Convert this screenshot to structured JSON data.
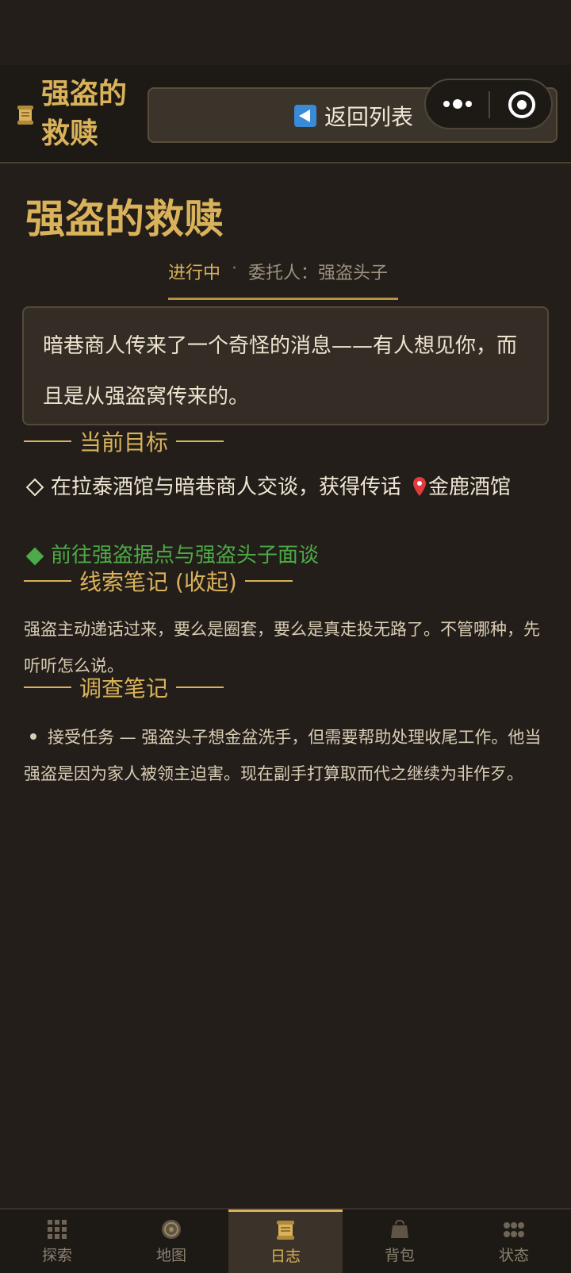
{
  "header": {
    "title": "强盗的救赎",
    "back_label": "返回列表"
  },
  "quest": {
    "title": "强盗的救赎",
    "status": "进行中",
    "separator": "·",
    "client": "委托人：强盗头子",
    "description": "暗巷商人传来了一个奇怪的消息——有人想见你，而且是从强盗窝传来的。"
  },
  "objectives": {
    "heading": "当前目标",
    "items": [
      {
        "text": "在拉泰酒馆与暗巷商人交谈，获得传话",
        "location": "金鹿酒馆",
        "done": false
      },
      {
        "text": "前往强盗据点与强盗头子面谈",
        "done": false,
        "current": true
      }
    ]
  },
  "clues": {
    "heading": "线索笔记 (收起)",
    "text": "强盗主动递话过来，要么是圈套，要么是真走投无路了。不管哪种，先听听怎么说。"
  },
  "investigation": {
    "heading": "调查笔记",
    "entries": [
      "接受任务 — 强盗头子想金盆洗手，但需要帮助处理收尾工作。他当强盗是因为家人被领主迫害。现在副手打算取而代之继续为非作歹。"
    ]
  },
  "tabs": [
    {
      "label": "探索",
      "icon": "grid-icon"
    },
    {
      "label": "地图",
      "icon": "compass-icon"
    },
    {
      "label": "日志",
      "icon": "scroll-icon",
      "active": true
    },
    {
      "label": "背包",
      "icon": "bag-icon"
    },
    {
      "label": "状态",
      "icon": "dots-icon"
    }
  ],
  "colors": {
    "accent": "#d9b25a",
    "background": "#231e19",
    "objective_active": "#4caa47"
  }
}
